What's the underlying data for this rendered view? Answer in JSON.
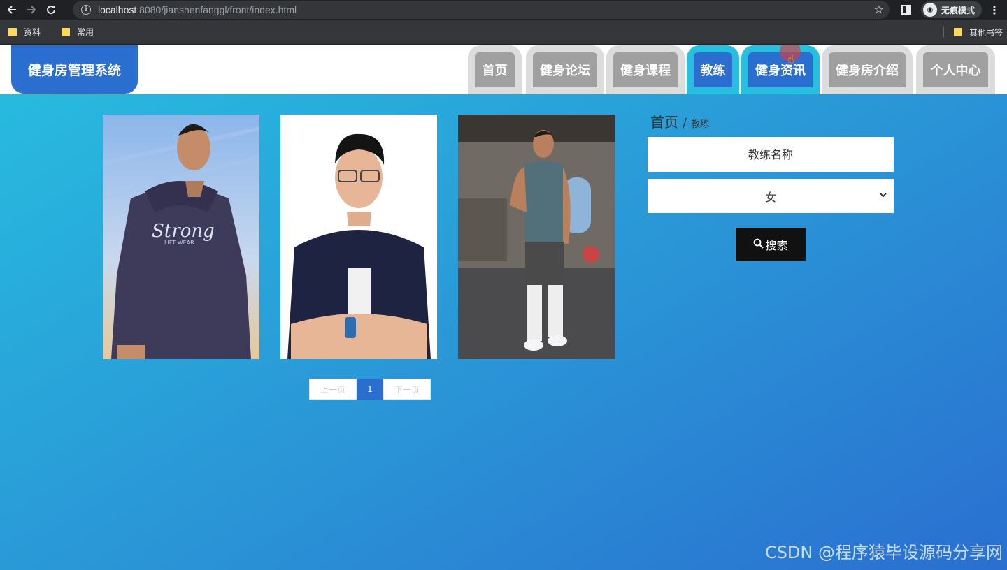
{
  "browser": {
    "url_host": "localhost",
    "url_path": ":8080/jianshenfanggl/front/index.html",
    "incognito_label": "无痕模式",
    "bookmarks": [
      "资料",
      "常用"
    ],
    "other_bookmarks": "其他书签"
  },
  "site": {
    "logo": "健身房管理系统",
    "nav": [
      {
        "label": "首页",
        "active": false
      },
      {
        "label": "健身论坛",
        "active": false
      },
      {
        "label": "健身课程",
        "active": false
      },
      {
        "label": "教练",
        "active": true
      },
      {
        "label": "健身资讯",
        "active": true
      },
      {
        "label": "健身房介绍",
        "active": false
      },
      {
        "label": "个人中心",
        "active": false
      }
    ]
  },
  "pager": {
    "prev": "上一页",
    "current": "1",
    "next": "下一页"
  },
  "search": {
    "breadcrumb_home": "首页",
    "breadcrumb_sep": "/",
    "breadcrumb_current": "教练",
    "name_placeholder": "教练名称",
    "sex_value": "女",
    "search_label": "搜索"
  },
  "watermark": "CSDN @程序猿毕设源码分享网",
  "colors": {
    "primary": "#2a6fd0",
    "accent": "#27bedf",
    "tab_gray": "#a0a0a0"
  }
}
